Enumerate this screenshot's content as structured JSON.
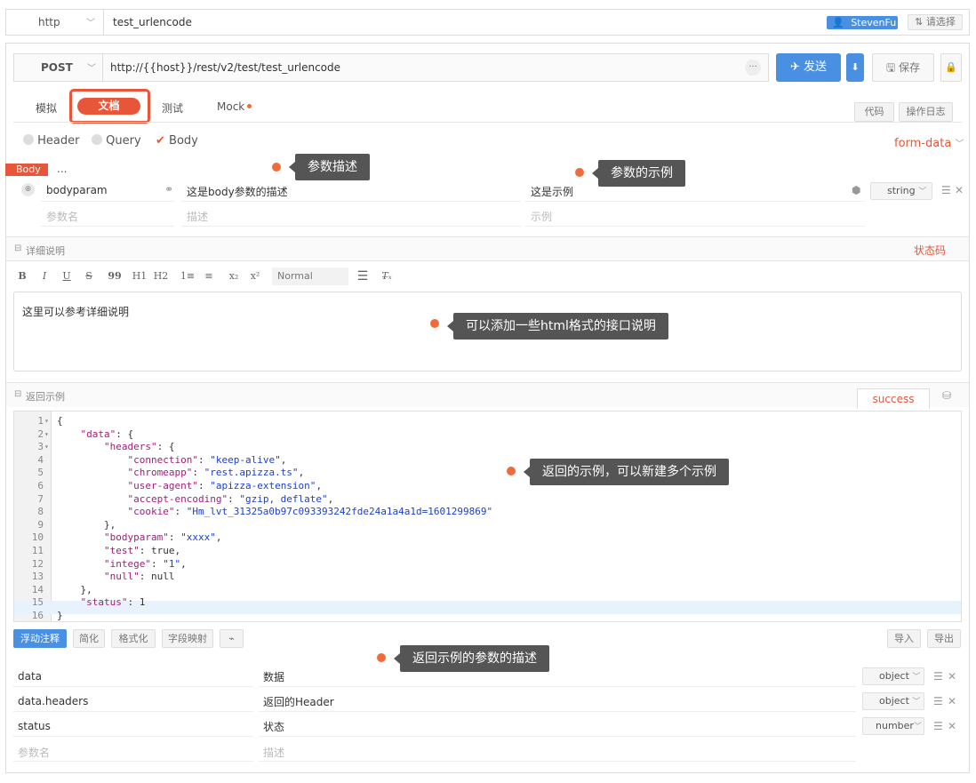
{
  "topbar": {
    "protocol": "http",
    "name": "test_urlencode",
    "user": "StevenFu",
    "choose": "请选择"
  },
  "request": {
    "method": "POST",
    "url": "http://{{host}}/rest/v2/test/test_urlencode",
    "more": "···",
    "send": "发送",
    "download": "⬇",
    "save": "保存"
  },
  "tabs": {
    "simulate": "模拟",
    "docs": "文档",
    "test": "测试",
    "mock": "Mock",
    "code": "代码",
    "oplog": "操作日志"
  },
  "params": {
    "header": "Header",
    "query": "Query",
    "body": "Body",
    "format": "form-data",
    "body_tag": "Body",
    "body_more": "...",
    "row": {
      "name": "bodyparam",
      "desc": "这是body参数的描述",
      "example": "这是示例",
      "type": "string"
    },
    "ph_name": "参数名",
    "ph_desc": "描述",
    "ph_example": "示例"
  },
  "callouts": {
    "desc": "参数描述",
    "example": "参数的示例",
    "html": "可以添加一些html格式的接口说明",
    "response": "返回的示例，可以新建多个示例",
    "resp_desc": "返回示例的参数的描述"
  },
  "detail": {
    "title": "详细说明",
    "status_code": "状态码",
    "tb": [
      "B",
      "I",
      "U",
      "S",
      "99",
      "H1",
      "H2",
      "1≡",
      "≡",
      "x₂",
      "x²"
    ],
    "heading_select": "Normal",
    "text": "这里可以参考详细说明"
  },
  "response": {
    "title": "返回示例",
    "tab": "success",
    "lines": [
      "{",
      "    \"data\": {",
      "        \"headers\": {",
      "            \"connection\": \"keep-alive\",",
      "            \"chromeapp\": \"rest.apizza.ts\",",
      "            \"user-agent\": \"apizza-extension\",",
      "            \"accept-encoding\": \"gzip, deflate\",",
      "            \"cookie\": \"Hm_lvt_31325a0b97c093393242fde24a1a4a1d=1601299869\"",
      "        },",
      "        \"bodyparam\": \"xxxx\",",
      "        \"test\": true,",
      "        \"intege\": \"1\",",
      "        \"null\": null",
      "    },",
      "    \"status\": 1",
      "}"
    ],
    "tools": [
      "浮动注释",
      "简化",
      "格式化",
      "字段映射"
    ],
    "import": "导入",
    "export": "导出",
    "fields": [
      {
        "name": "data",
        "desc": "数据",
        "type": "object"
      },
      {
        "name": "data.headers",
        "desc": "返回的Header",
        "type": "object"
      },
      {
        "name": "status",
        "desc": "状态",
        "type": "number"
      }
    ],
    "ph_name": "参数名",
    "ph_desc": "描述"
  },
  "colors": {
    "accent": "#4a90e2",
    "orange": "#e8563a",
    "callout": "#555555"
  }
}
